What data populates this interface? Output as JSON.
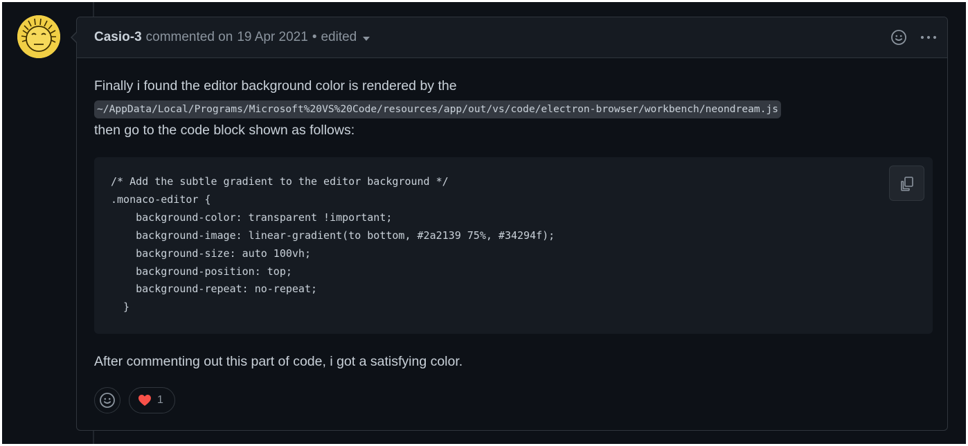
{
  "comment": {
    "author": "Casio-3",
    "action": "commented on",
    "date": "19 Apr 2021",
    "separator": "•",
    "edited_label": "edited"
  },
  "body": {
    "intro": "Finally i found the editor background color is rendered by the",
    "path_code": "~/AppData/Local/Programs/Microsoft%20VS%20Code/resources/app/out/vs/code/electron-browser/workbench/neondream.js",
    "then_text": "then go to the code block shown as follows:",
    "code_block": "/* Add the subtle gradient to the editor background */\n.monaco-editor {\n    background-color: transparent !important;\n    background-image: linear-gradient(to bottom, #2a2139 75%, #34294f);\n    background-size: auto 100vh;\n    background-position: top;\n    background-repeat: no-repeat;\n  }",
    "after_text": "After commenting out this part of code, i got a satisfying color."
  },
  "reactions": {
    "heart_count": "1",
    "heart_icon": "heart-icon",
    "add_icon": "smiley-icon"
  },
  "colors": {
    "background": "#0d1117",
    "header_bg": "#161b22",
    "border": "#30363d",
    "text": "#c9d1d9",
    "muted": "#8b949e",
    "heart": "#f85149",
    "avatar": "#f1cf45"
  }
}
